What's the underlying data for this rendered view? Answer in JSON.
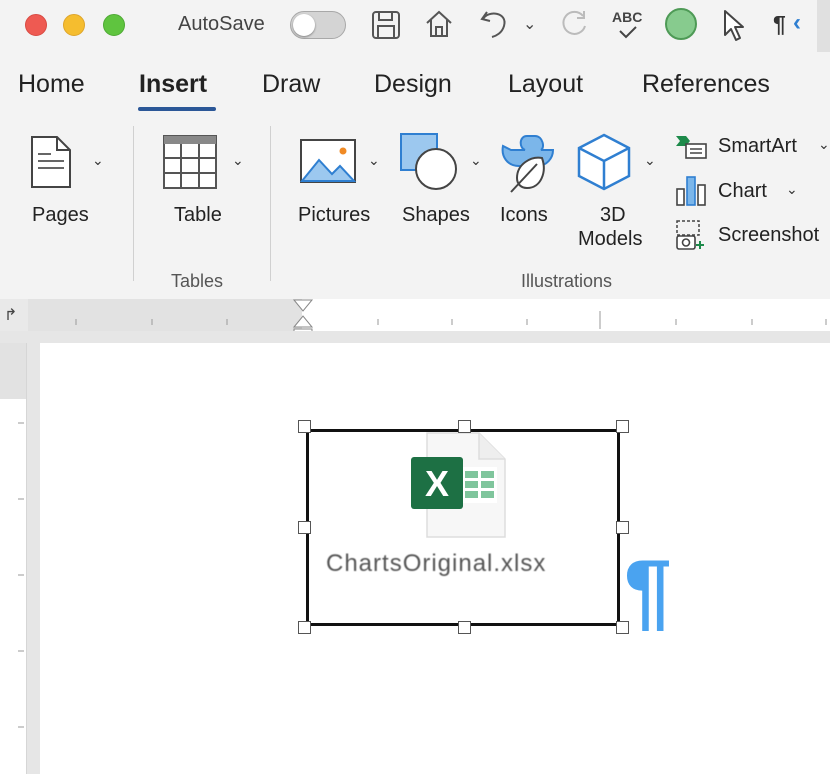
{
  "titlebar": {
    "autosave_label": "AutoSave",
    "autosave_on": false,
    "spellcheck_label": "ABC",
    "pilcrow_label": "¶"
  },
  "tabs": [
    {
      "label": "Home",
      "active": false
    },
    {
      "label": "Insert",
      "active": true
    },
    {
      "label": "Draw",
      "active": false
    },
    {
      "label": "Design",
      "active": false
    },
    {
      "label": "Layout",
      "active": false
    },
    {
      "label": "References",
      "active": false
    }
  ],
  "ribbon": {
    "pages": {
      "label": "Pages"
    },
    "table": {
      "label": "Table"
    },
    "tables_group": "Tables",
    "pictures": {
      "label": "Pictures"
    },
    "shapes": {
      "label": "Shapes"
    },
    "icons": {
      "label": "Icons"
    },
    "models": {
      "label_line1": "3D",
      "label_line2": "Models"
    },
    "smartart": {
      "label": "SmartArt"
    },
    "chart": {
      "label": "Chart"
    },
    "screenshot": {
      "label": "Screenshot"
    },
    "illustrations_group": "Illustrations"
  },
  "document": {
    "embedded_file": {
      "name": "ChartsOriginal.xlsx",
      "app_letter": "X"
    },
    "pilcrow": "¶"
  },
  "colors": {
    "accent": "#2b5797",
    "excel_green": "#1d7044",
    "icon_blue": "#2f7fd1",
    "pilcrow_blue": "#4aa3f0"
  }
}
